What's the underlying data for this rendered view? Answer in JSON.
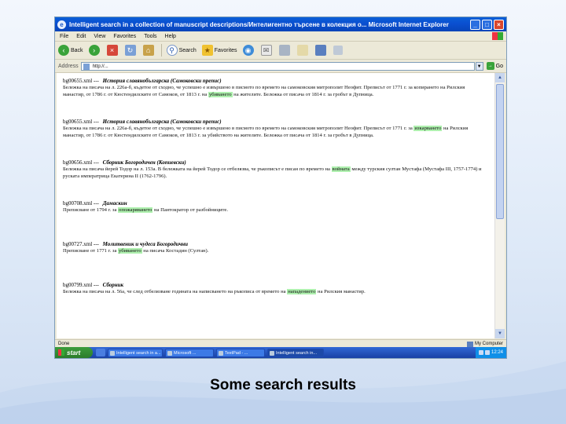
{
  "window": {
    "title": "Intelligent search in a collection of manuscript descriptions/Интелигентно търсене в колекция о... Microsoft Internet Explorer",
    "min": "_",
    "max": "□",
    "close": "×"
  },
  "menu": [
    "File",
    "Edit",
    "View",
    "Favorites",
    "Tools",
    "Help"
  ],
  "toolbar": {
    "back": "Back",
    "search": "Search",
    "favorites": "Favorites"
  },
  "address": {
    "label": "Address",
    "value": "http://...",
    "go": "Go"
  },
  "results": [
    {
      "file": "bg00655.xml --- ",
      "title": "История славянобългарска (Самоковски препис)",
      "text": [
        {
          "t": "Бележка на писача на л. 226а-б, къдетое от сходно, че успешно е извършено в писмото по времето на самоковския митрополит Неофит. Преписът от 1771 г. за копирането на Рилския манастир, от 1786 г. от Кюстендилските от Самоков, от 1813 г. на "
        },
        {
          "t": "убиването",
          "hl": true
        },
        {
          "t": " на жителите. Бележка от писача от 1814 г. за гробът в Дупница."
        }
      ]
    },
    {
      "file": "bg00655.xml --- ",
      "title": "История славянобългарска (Самоковски препис)",
      "text": [
        {
          "t": "Бележка на писача на л. 226а-б, къдетое от сходно, че успешно е извършено в писмото по времето на самоковския митрополит Неофит. Преписът от 1771 г. за "
        },
        {
          "t": "изкарването",
          "hl": true
        },
        {
          "t": " на Рилския манастир, от 1786 г. от Кюстендилските от Самоков, от 1813 г. за убийството на жителите. Бележка от писача от 1814 г. за гробът в Дупница."
        }
      ]
    },
    {
      "file": "bg00656.xml --- ",
      "title": "Сборник Богородичен (Копиевски)",
      "text": [
        {
          "t": "Бележка на писача йерей Тодор на л. 153а. В бележката на йерей Тодор се отбелязва, че ръкописът е писан по времето на "
        },
        {
          "t": "войната",
          "hl": true
        },
        {
          "t": " между турския султан Мустафа (Мустафа III, 1757-1774) и руската императрица Екатерина II (1762-1796)."
        }
      ]
    },
    {
      "file": "bg00708.xml --- ",
      "title": "Дамаскин",
      "text": [
        {
          "t": "Преписване от 1794 г. за "
        },
        {
          "t": "опожаряването",
          "hl": true
        },
        {
          "t": " на Пантократор от разбойниците."
        }
      ]
    },
    {
      "file": "bg00727.xml --- ",
      "title": "Молитвеник и чудеса Богородични",
      "text": [
        {
          "t": "Преписване от 1771 г. за "
        },
        {
          "t": "убиването",
          "hl": true
        },
        {
          "t": " на писача Костадин (Султан)."
        }
      ]
    },
    {
      "file": "bg00799.xml --- ",
      "title": "Сборник",
      "text": [
        {
          "t": "Бележка на писача на л. 56а, че след отбелязване годината на написването на ръкописа от времето на "
        },
        {
          "t": "нападението",
          "hl": true
        },
        {
          "t": " на Рилския манастир."
        }
      ]
    }
  ],
  "status": {
    "left": "Done",
    "right": "My Computer"
  },
  "taskbar": {
    "start": "start",
    "tasks": [
      "Intelligent search in a...",
      "Microsoft ...",
      "TextPad - ...",
      "Intelligent search in..."
    ],
    "clock": "12:24"
  },
  "caption": "Some search results"
}
